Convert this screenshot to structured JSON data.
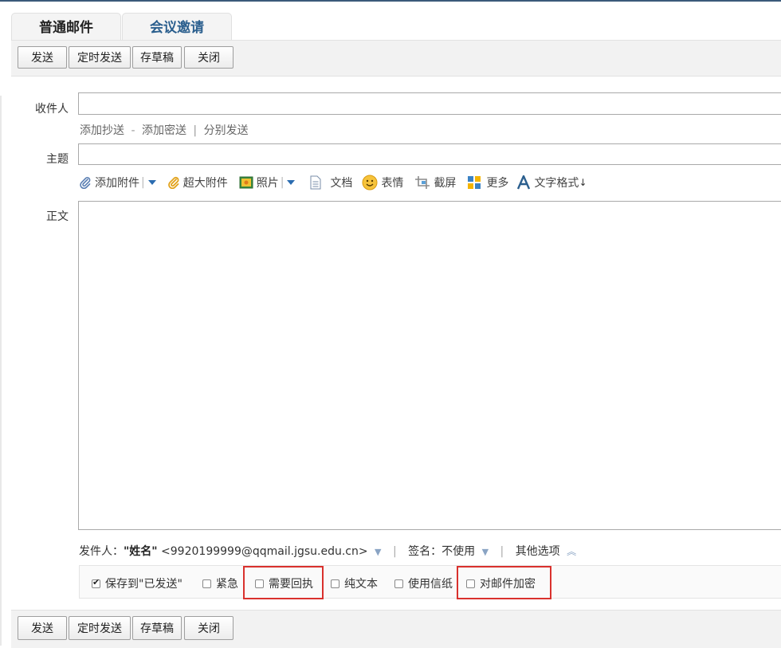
{
  "tabs": {
    "normal": "普通邮件",
    "meeting": "会议邀请"
  },
  "toolbar": {
    "send": "发送",
    "scheduled_send": "定时发送",
    "save_draft": "存草稿",
    "close": "关闭"
  },
  "form": {
    "to_label": "收件人",
    "to_value": "",
    "links": {
      "add_cc": "添加抄送",
      "dash": "-",
      "add_bcc": "添加密送",
      "bar": "|",
      "separate_send": "分别发送"
    },
    "subject_label": "主题",
    "subject_value": "",
    "attach_bar": {
      "add_attachment": "添加附件",
      "large_attachment": "超大附件",
      "photo": "照片",
      "document": "文档",
      "emoji": "表情",
      "screenshot": "截屏",
      "more": "更多",
      "text_format": "文字格式"
    },
    "body_label": "正文",
    "body_value": ""
  },
  "sender": {
    "label": "发件人：",
    "name": "\"姓名\"",
    "email": "<9920199999@qqmail.jgsu.edu.cn>",
    "signature_label": "签名：",
    "signature_value": "不使用",
    "other_options": "其他选项",
    "sep": "|"
  },
  "options": {
    "save_to_sent": {
      "label": "保存到\"已发送\"",
      "checked": true
    },
    "urgent": {
      "label": "紧急",
      "checked": false
    },
    "read_receipt": {
      "label": "需要回执",
      "checked": false
    },
    "plain_text": {
      "label": "纯文本",
      "checked": false
    },
    "stationery": {
      "label": "使用信纸",
      "checked": false
    },
    "encrypt": {
      "label": "对邮件加密",
      "checked": false
    }
  },
  "colors": {
    "accent_link": "#2b5f8e",
    "highlight": "#d9312d",
    "dropdown_blue": "#2b6cb0"
  },
  "icons": [
    "paperclip-icon",
    "dropdown-arrow-icon",
    "photo-icon",
    "document-icon",
    "emoji-icon",
    "screenshot-icon",
    "more-apps-icon",
    "text-format-icon",
    "checkbox-icon",
    "double-chevron-up-icon"
  ]
}
